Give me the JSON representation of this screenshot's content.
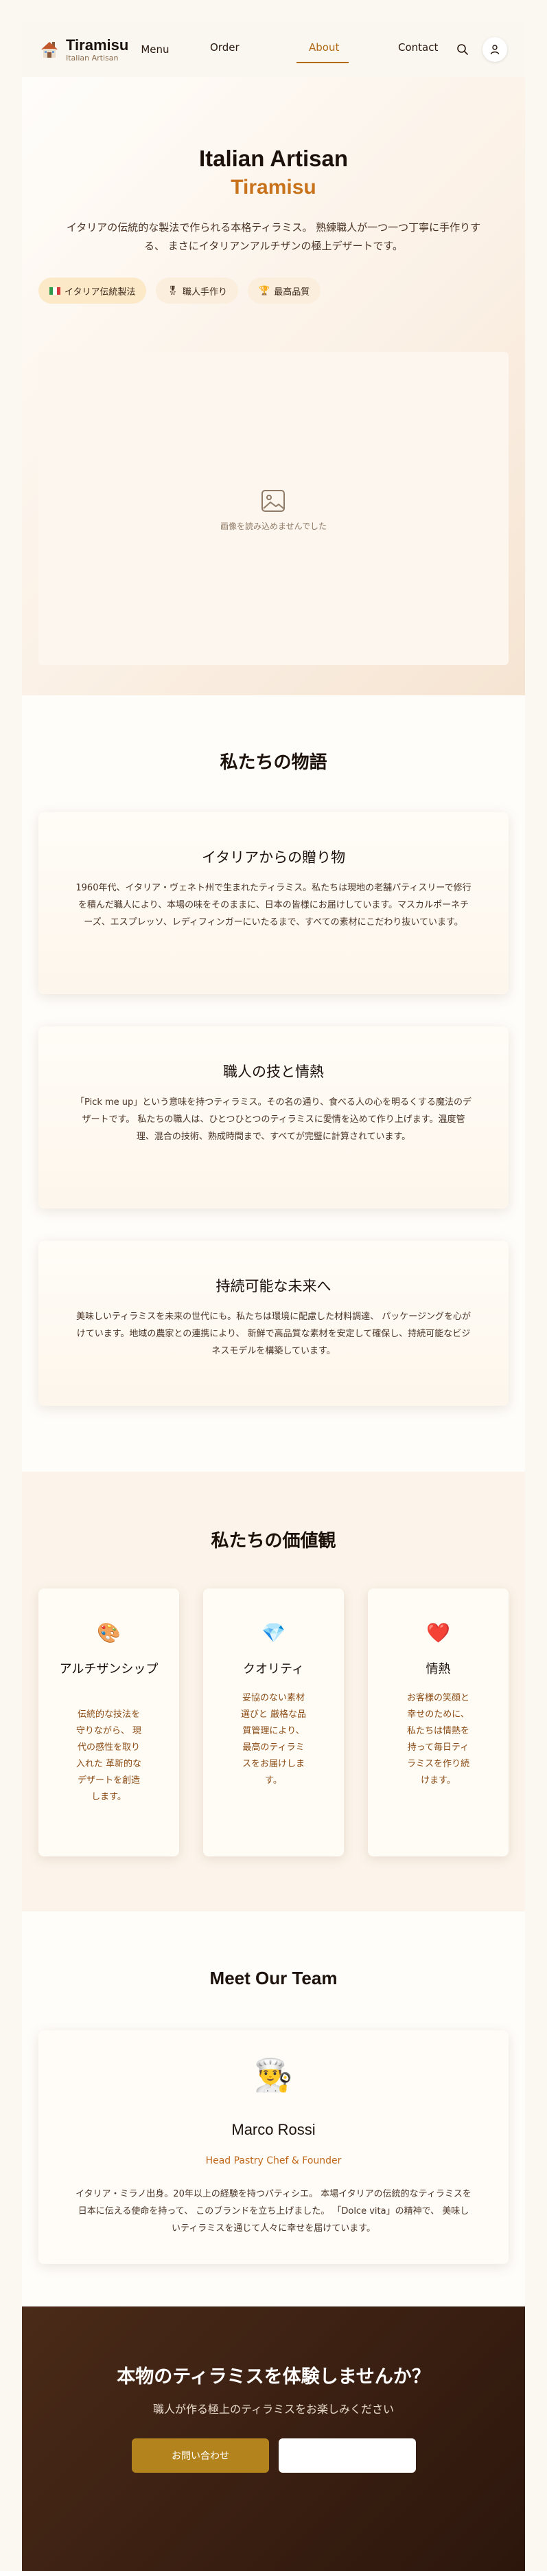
{
  "header": {
    "logo_title": "Tiramisu",
    "logo_subtitle": "Italian Artisan",
    "menu_label": "Menu",
    "nav": [
      {
        "label": "Order"
      },
      {
        "label": "About",
        "active": true
      },
      {
        "label": "Contact"
      }
    ],
    "icons": [
      "search-icon",
      "user-icon"
    ],
    "accent_color": "#b26a14"
  },
  "hero": {
    "title": "Italian Artisan",
    "subtitle": "Tiramisu",
    "description": "イタリアの伝統的な製法で作られる本格ティラミス。 熟練職人が一つ一つ丁寧に手作りする、 まさにイタリアンアルチザンの極上デザートです。",
    "badges": [
      {
        "icon": "italy-flag-icon",
        "label": "イタリア伝統製法"
      },
      {
        "icon": "medal-icon",
        "label": "職人手作り"
      },
      {
        "icon": "trophy-icon",
        "label": "最高品質"
      }
    ],
    "image_fallback": "画像を読み込めませんでした"
  },
  "story": {
    "title": "私たちの物語",
    "cards": [
      {
        "title": "イタリアからの贈り物",
        "body": "1960年代、イタリア・ヴェネト州で生まれたティラミス。私たちは現地の老舗パティスリーで修行を積んだ職人により、本場の味をそのままに、日本の皆様にお届けしています。マスカルポーネチーズ、エスプレッソ、レディフィンガーにいたるまで、すべての素材にこだわり抜いています。"
      },
      {
        "title": "職人の技と情熱",
        "body": "「Pick me up」という意味を持つティラミス。その名の通り、食べる人の心を明るくする魔法のデザートです。 私たちの職人は、ひとつひとつのティラミスに愛情を込めて作り上げます。温度管理、混合の技術、熟成時間まで、すべてが完璧に計算されています。"
      },
      {
        "title": "持続可能な未来へ",
        "body": "美味しいティラミスを未来の世代にも。私たちは環境に配慮した材料調達、 パッケージングを心がけています。地域の農家との連携により、 新鮮で高品質な素材を安定して確保し、持続可能なビジネスモデルを構築しています。"
      }
    ]
  },
  "values": {
    "title": "私たちの価値観",
    "items": [
      {
        "icon": "palette-icon",
        "glyph": "🎨",
        "title": "アルチザンシップ",
        "desc": "伝統的な技法を守りながら、 現代の感性を取り入れた 革新的なデザートを創造します。"
      },
      {
        "icon": "gem-icon",
        "glyph": "💎",
        "title": "クオリティ",
        "desc": "妥協のない素材選びと 厳格な品質管理により、 最高のティラミスをお届けします。"
      },
      {
        "icon": "heart-icon",
        "glyph": "❤️",
        "title": "情熱",
        "desc": "お客様の笑顔と幸せのために、 私たちは情熱を持って毎日ティラミスを作り続けます。"
      }
    ]
  },
  "team": {
    "title": "Meet Our Team",
    "members": [
      {
        "icon": "chef-avatar-icon",
        "glyph": "👨‍🍳",
        "name": "Marco Rossi",
        "role": "Head Pastry Chef & Founder",
        "bio": "イタリア・ミラノ出身。20年以上の経験を持つパティシエ。 本場イタリアの伝統的なティラミスを日本に伝える使命を持って、 このブランドを立ち上げました。 「Dolce vita」の精神で、 美味しいティラミスを通じて人々に幸せを届けています。"
      }
    ]
  },
  "cta": {
    "title": "本物のティラミスを体験しませんか？",
    "subtitle": "職人が作る極上のティラミスをお楽しみください",
    "primary_label": "お問い合わせ",
    "secondary_label": ""
  }
}
